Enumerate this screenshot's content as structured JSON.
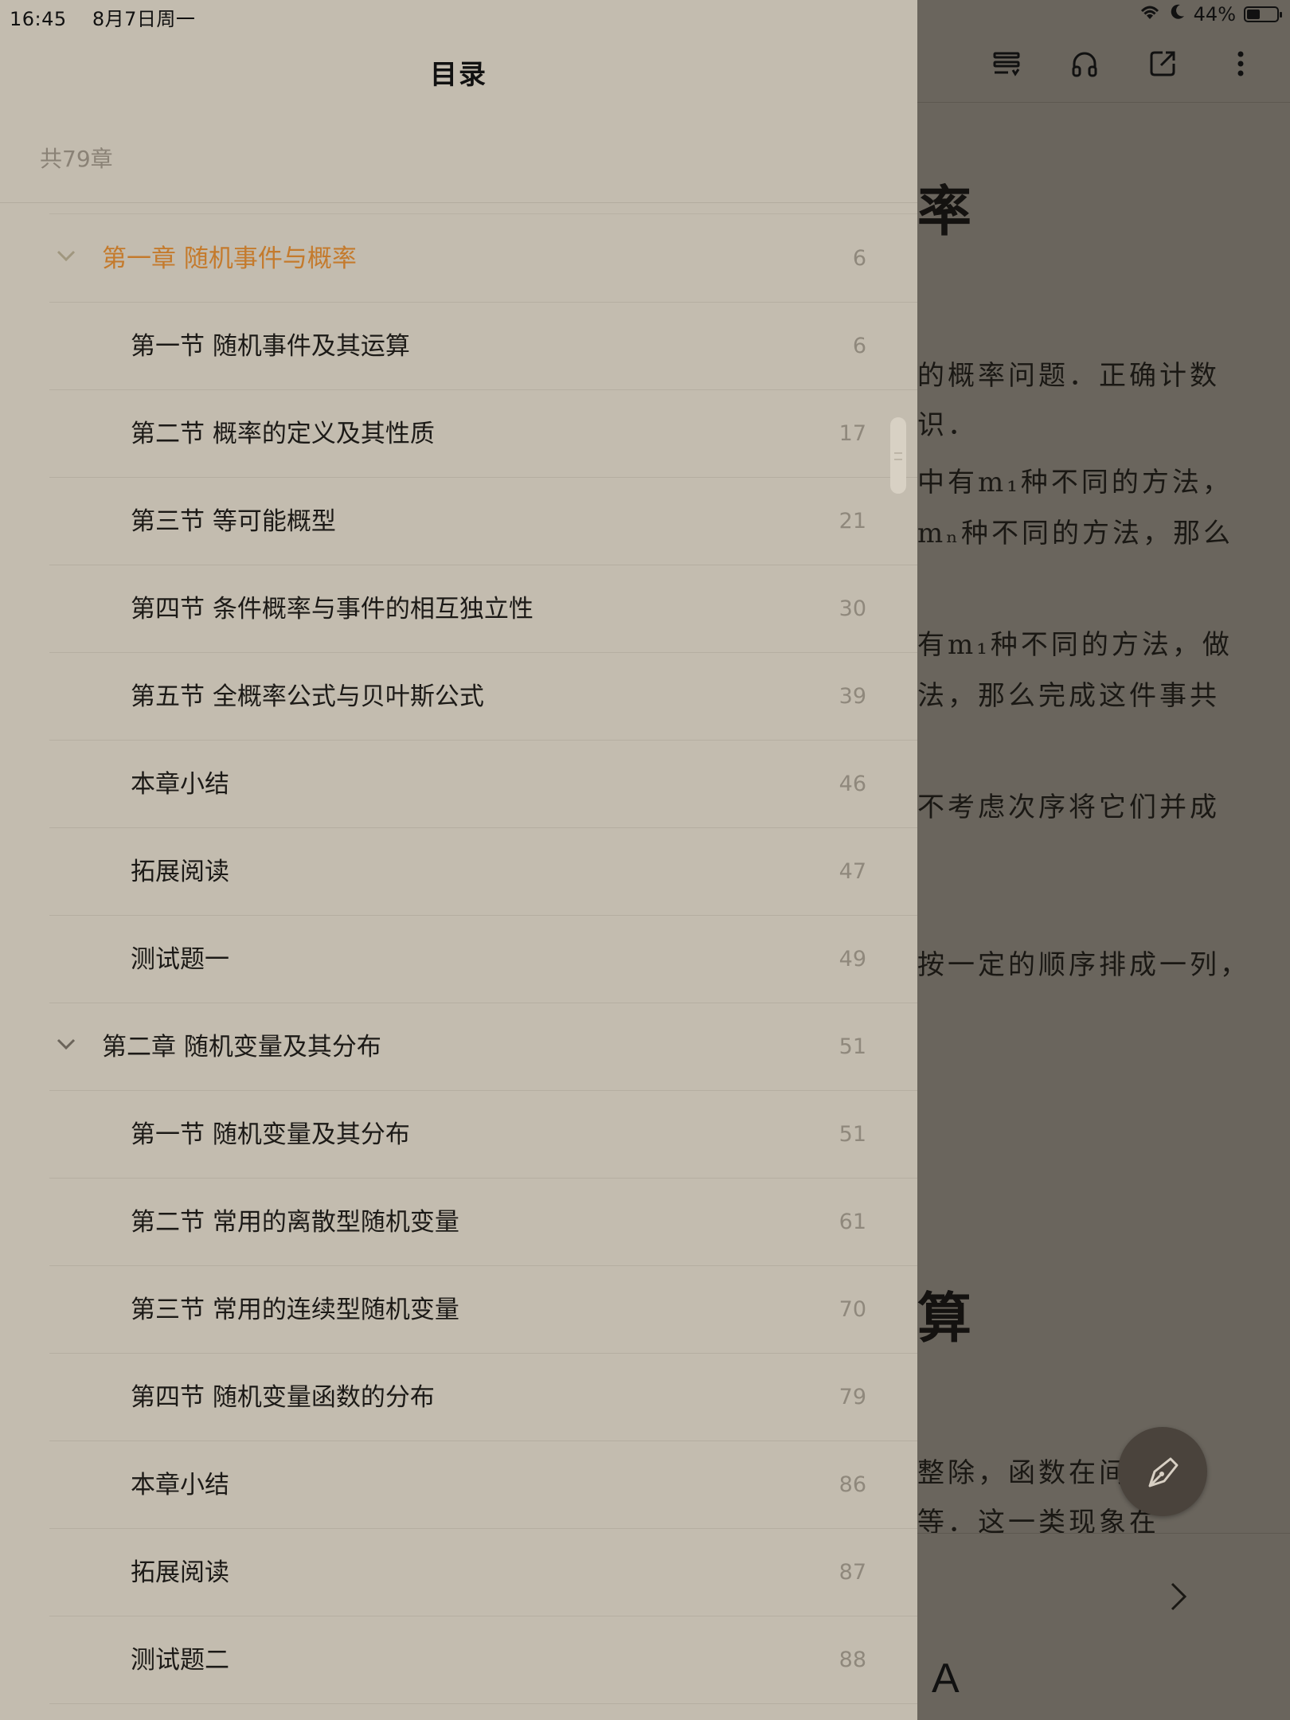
{
  "status_bar": {
    "time": "16:45",
    "date": "8月7日周一",
    "battery": "44%",
    "battery_level": 0.44
  },
  "toc_panel": {
    "title": "目录",
    "chapter_count": "共79章",
    "items": [
      {
        "kind": "chapter",
        "label": "第一章 随机事件与概率",
        "page": "6",
        "active": true
      },
      {
        "kind": "section",
        "label": "第一节 随机事件及其运算",
        "page": "6"
      },
      {
        "kind": "section",
        "label": "第二节 概率的定义及其性质",
        "page": "17"
      },
      {
        "kind": "section",
        "label": "第三节 等可能概型",
        "page": "21"
      },
      {
        "kind": "section",
        "label": "第四节 条件概率与事件的相互独立性",
        "page": "30"
      },
      {
        "kind": "section",
        "label": "第五节 全概率公式与贝叶斯公式",
        "page": "39"
      },
      {
        "kind": "section",
        "label": "本章小结",
        "page": "46"
      },
      {
        "kind": "section",
        "label": "拓展阅读",
        "page": "47"
      },
      {
        "kind": "section",
        "label": "测试题一",
        "page": "49"
      },
      {
        "kind": "chapter",
        "label": "第二章 随机变量及其分布",
        "page": "51"
      },
      {
        "kind": "section",
        "label": "第一节 随机变量及其分布",
        "page": "51"
      },
      {
        "kind": "section",
        "label": "第二节 常用的离散型随机变量",
        "page": "61"
      },
      {
        "kind": "section",
        "label": "第三节 常用的连续型随机变量",
        "page": "70"
      },
      {
        "kind": "section",
        "label": "第四节 随机变量函数的分布",
        "page": "79"
      },
      {
        "kind": "section",
        "label": "本章小结",
        "page": "86"
      },
      {
        "kind": "section",
        "label": "拓展阅读",
        "page": "87"
      },
      {
        "kind": "section",
        "label": "测试题二",
        "page": "88"
      }
    ]
  },
  "reader": {
    "heading_1": "率",
    "heading_2": "算",
    "lines": [
      "的概率问题．正确计数",
      "识．",
      "中有m₁种不同的方法，",
      "mₙ种不同的方法，那么",
      "有m₁种不同的方法，做",
      "法，那么完成这件事共",
      "不考虑次序将它们并成",
      "按一定的顺序排成一列，",
      "整除，函数在间",
      "等．这一类现象在"
    ],
    "font_button": "A"
  },
  "colors": {
    "panel_bg": "#c3bcaf",
    "active_chapter": "#c47a2c",
    "reader_overlay": "#6a655d"
  }
}
